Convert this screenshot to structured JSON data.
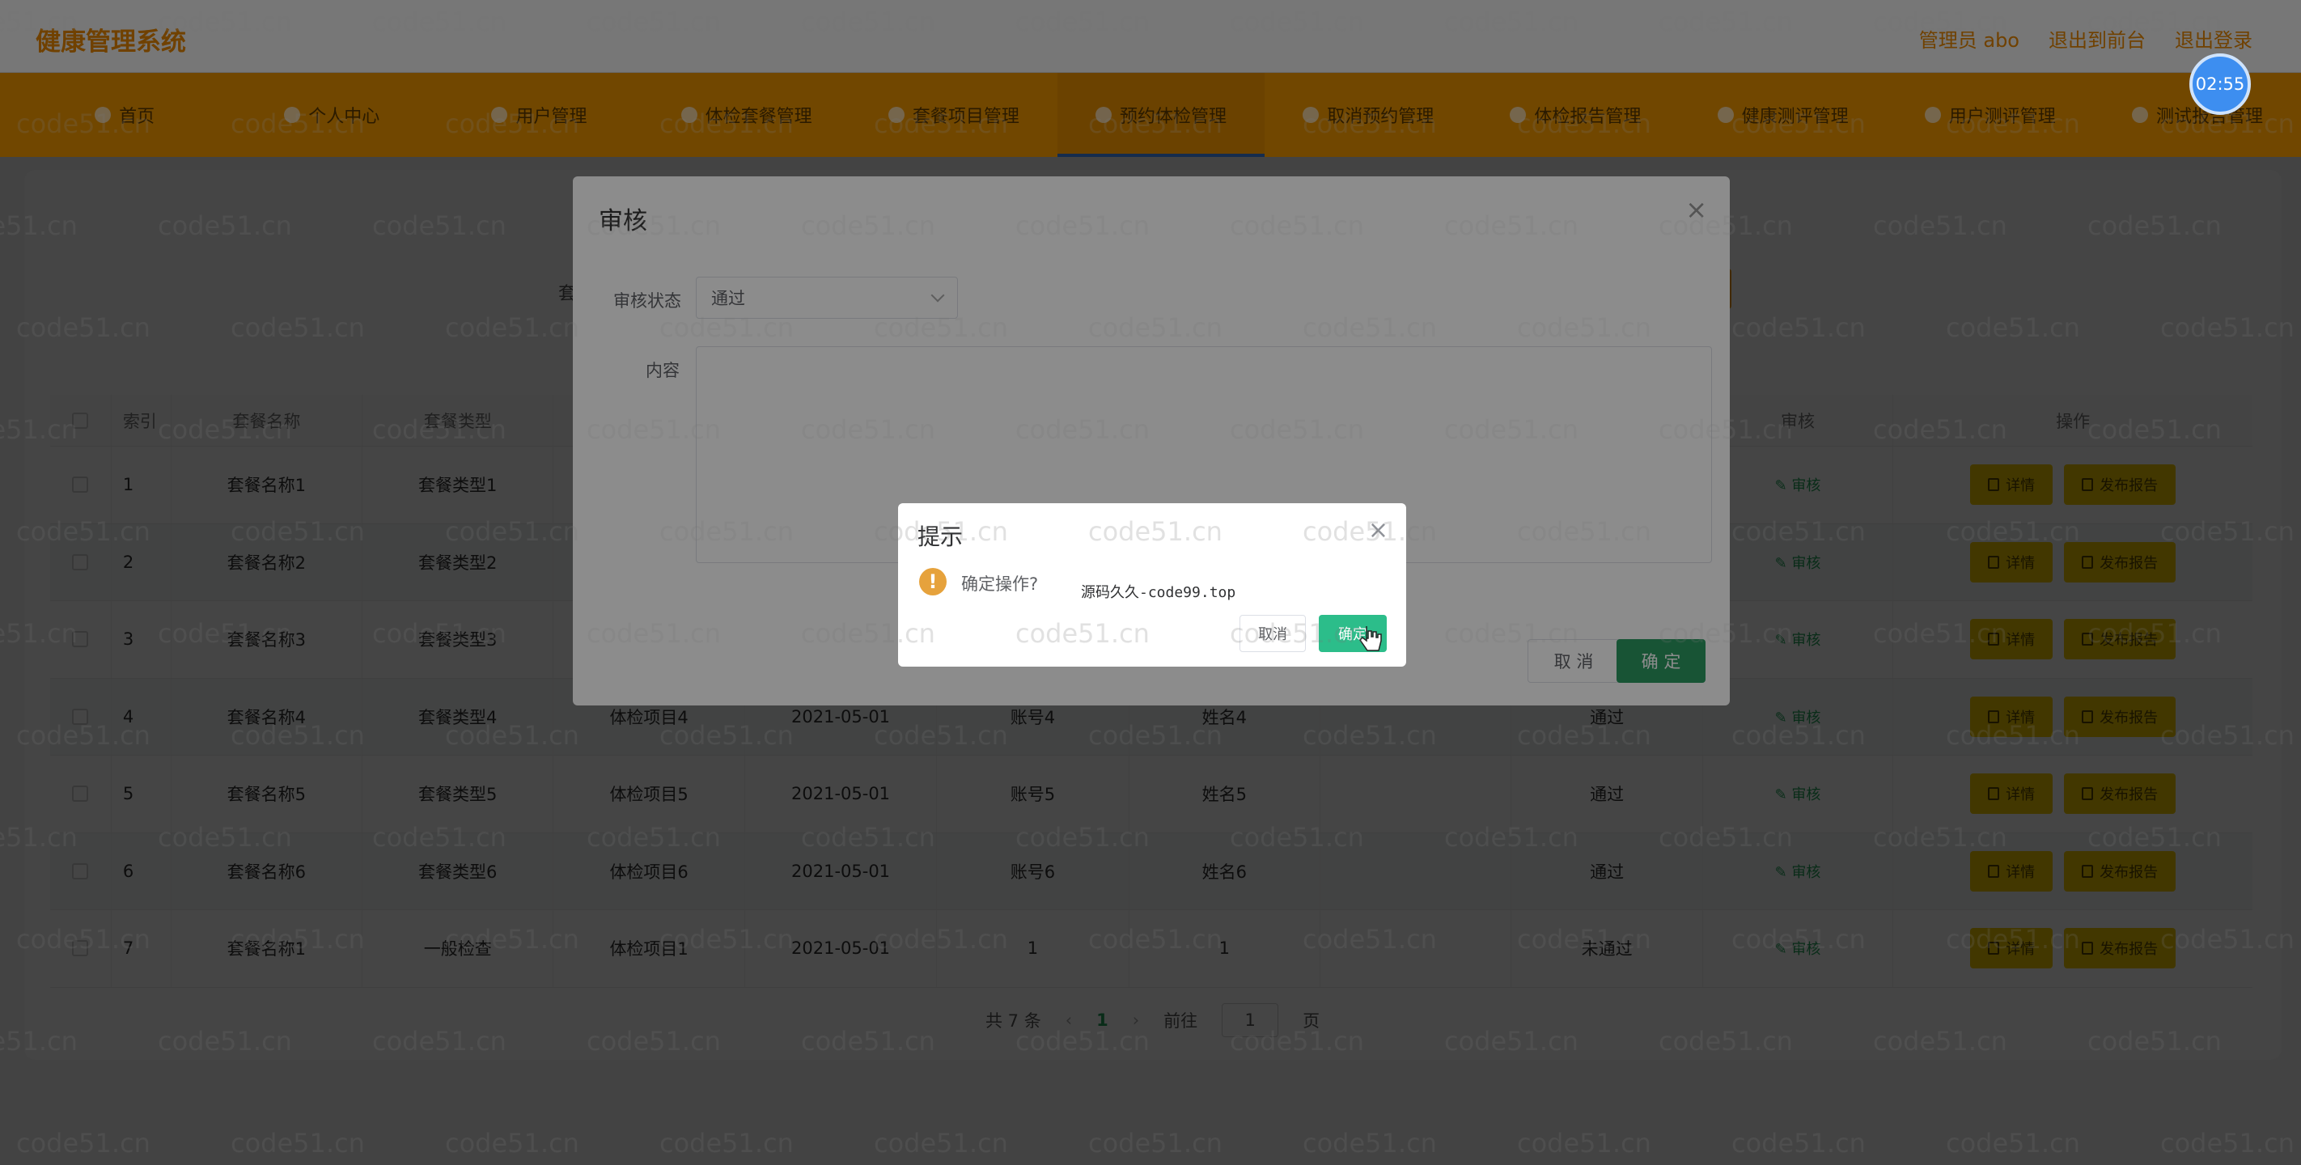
{
  "header": {
    "app_title": "健康管理系统",
    "links": [
      "管理员 abo",
      "退出到前台",
      "退出登录"
    ],
    "timer": "02:55"
  },
  "nav": {
    "items": [
      "首页",
      "个人中心",
      "用户管理",
      "体检套餐管理",
      "套餐项目管理",
      "预约体检管理",
      "取消预约管理",
      "体检报告管理",
      "健康测评管理",
      "用户测评管理",
      "测试报告管理"
    ],
    "active_index": 5
  },
  "search": {
    "label": "套"
  },
  "table": {
    "headers": [
      "",
      "索引",
      "套餐名称",
      "套餐类型",
      "",
      "",
      "",
      "",
      "",
      "",
      "审核",
      "操作"
    ],
    "rows": [
      {
        "index": "1",
        "name": "套餐名称1",
        "type": "套餐类型1",
        "item": "",
        "date": "",
        "account": "",
        "username": "",
        "status": ""
      },
      {
        "index": "2",
        "name": "套餐名称2",
        "type": "套餐类型2",
        "item": "",
        "date": "",
        "account": "",
        "username": "",
        "status": ""
      },
      {
        "index": "3",
        "name": "套餐名称3",
        "type": "套餐类型3",
        "item": "",
        "date": "",
        "account": "",
        "username": "",
        "status": ""
      },
      {
        "index": "4",
        "name": "套餐名称4",
        "type": "套餐类型4",
        "item": "体检项目4",
        "date": "2021-05-01",
        "account": "账号4",
        "username": "姓名4",
        "status": "通过"
      },
      {
        "index": "5",
        "name": "套餐名称5",
        "type": "套餐类型5",
        "item": "体检项目5",
        "date": "2021-05-01",
        "account": "账号5",
        "username": "姓名5",
        "status": "通过"
      },
      {
        "index": "6",
        "name": "套餐名称6",
        "type": "套餐类型6",
        "item": "体检项目6",
        "date": "2021-05-01",
        "account": "账号6",
        "username": "姓名6",
        "status": "通过"
      },
      {
        "index": "7",
        "name": "套餐名称1",
        "type": "一般检查",
        "item": "体检项目1",
        "date": "2021-05-01",
        "account": "1",
        "username": "1",
        "status": "未通过"
      }
    ],
    "audit_label": "审核",
    "detail_label": "详情",
    "publish_label": "发布报告"
  },
  "pager": {
    "total": "共 7 条",
    "prev": "‹",
    "current": "1",
    "next": "›",
    "goto": "前往",
    "page_value": "1",
    "page_suffix": "页"
  },
  "audit_dialog": {
    "title": "审核",
    "close": "×",
    "status_label": "审核状态",
    "status_value": "通过",
    "content_label": "内容",
    "cancel": "取 消",
    "confirm": "确 定"
  },
  "confirm_box": {
    "title": "提示",
    "close": "×",
    "icon": "!",
    "message": "确定操作?",
    "side_text": "源码久久-code99.top",
    "cancel": "取消",
    "confirm": "确定"
  },
  "watermark": "code51.cn",
  "colors": {
    "accent": "#f39800",
    "primary_green": "#2c9a62",
    "confirm_green": "#2cbd8a",
    "warning": "#e6a23c",
    "button_yellow": "#f0c800"
  }
}
